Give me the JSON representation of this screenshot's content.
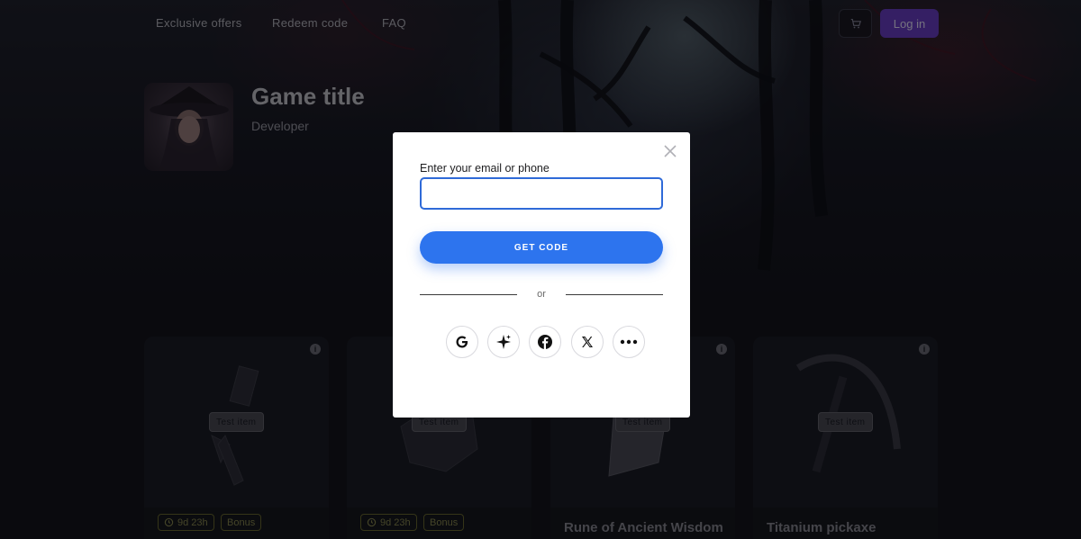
{
  "nav": {
    "links": [
      "Exclusive offers",
      "Redeem code",
      "FAQ"
    ],
    "login_label": "Log in",
    "cart_icon": "cart-icon"
  },
  "game": {
    "title": "Game title",
    "developer": "Developer"
  },
  "cards": [
    {
      "tag": "Test item",
      "timer": "9d 23h",
      "badge": "Bonus",
      "name": ""
    },
    {
      "tag": "Test item",
      "timer": "9d 23h",
      "badge": "Bonus",
      "name": ""
    },
    {
      "tag": "Test item",
      "timer": "",
      "badge": "",
      "name": "Rune of Ancient Wisdom"
    },
    {
      "tag": "Test item",
      "timer": "",
      "badge": "",
      "name": "Titanium pickaxe"
    }
  ],
  "modal": {
    "label": "Enter your email or phone",
    "input_value": "",
    "input_placeholder": "",
    "submit_label": "GET CODE",
    "divider_text": "or",
    "social": [
      "google-icon",
      "sparkle-icon",
      "facebook-icon",
      "x-icon",
      "more-icon"
    ]
  },
  "colors": {
    "accent_login": "#6a3fc8",
    "submit_blue": "#2d74ee",
    "input_border": "#2f6ad8",
    "chip_olive": "#8a8a50"
  }
}
